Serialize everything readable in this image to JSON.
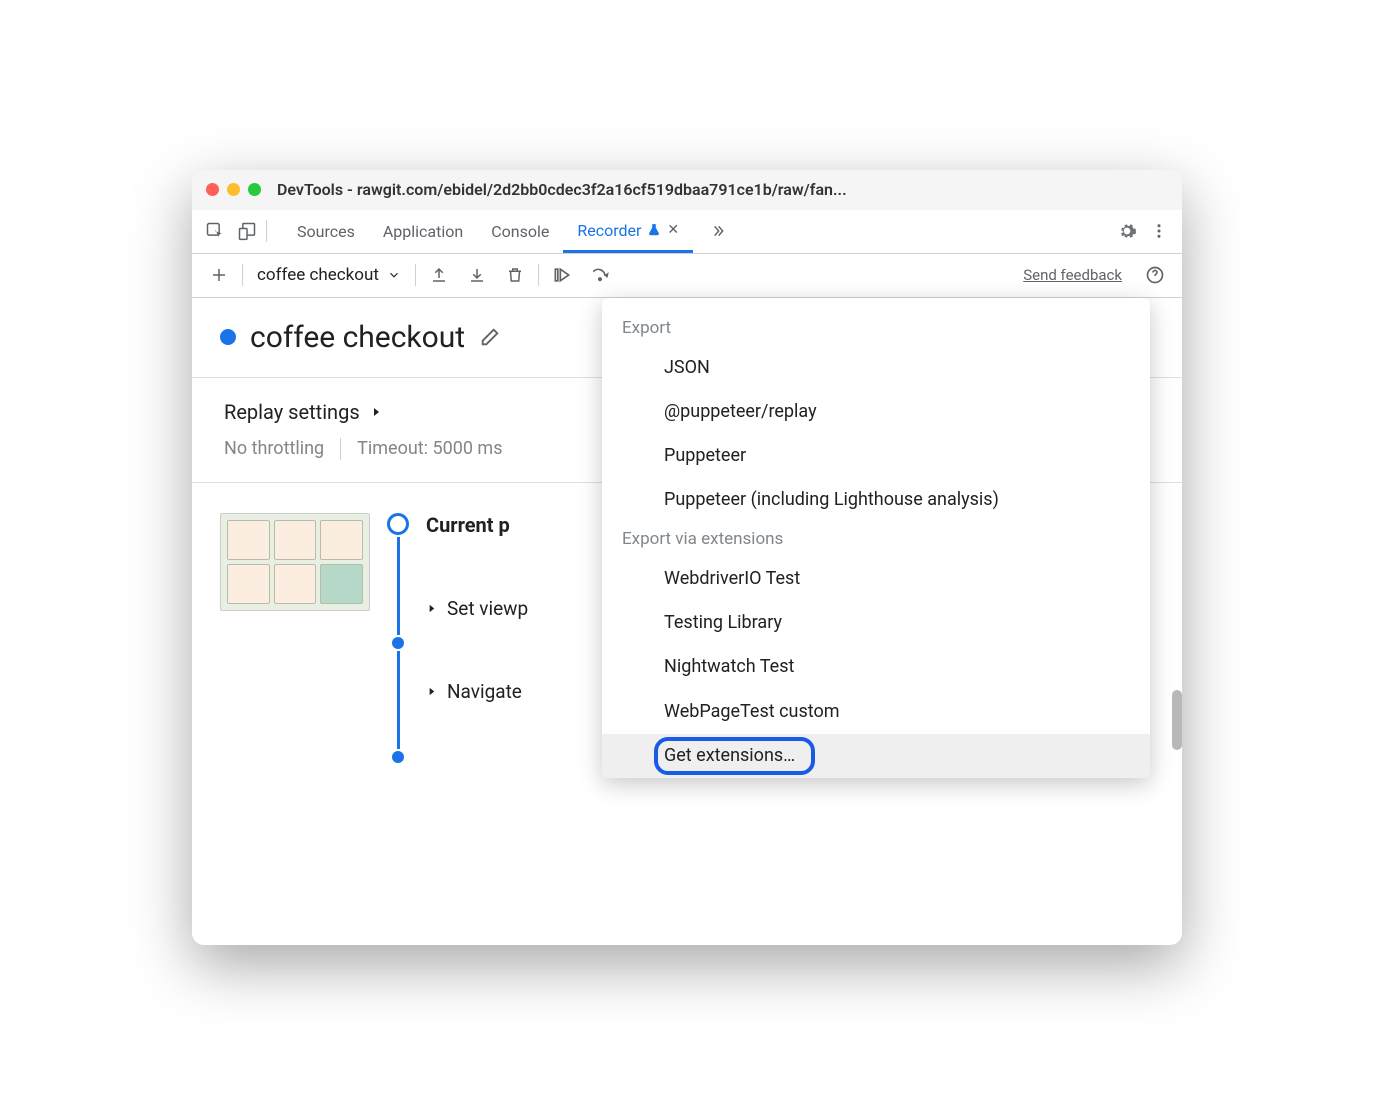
{
  "window": {
    "title": "DevTools - rawgit.com/ebidel/2d2bb0cdec3f2a16cf519dbaa791ce1b/raw/fan..."
  },
  "tabs": {
    "sources": "Sources",
    "application": "Application",
    "console": "Console",
    "recorder": "Recorder"
  },
  "toolbar": {
    "recording_name": "coffee checkout",
    "feedback": "Send feedback"
  },
  "recording": {
    "title": "coffee checkout",
    "replay_settings_label": "Replay settings",
    "throttling": "No throttling",
    "timeout": "Timeout: 5000 ms"
  },
  "steps": {
    "current_page": "Current p",
    "set_viewport": "Set viewp",
    "navigate": "Navigate"
  },
  "dropdown": {
    "section1": "Export",
    "items1": {
      "json": "JSON",
      "puppeteer_replay": "@puppeteer/replay",
      "puppeteer": "Puppeteer",
      "puppeteer_lh": "Puppeteer (including Lighthouse analysis)"
    },
    "section2": "Export via extensions",
    "items2": {
      "webdriverio": "WebdriverIO Test",
      "testing_library": "Testing Library",
      "nightwatch": "Nightwatch Test",
      "webpagetest": "WebPageTest custom",
      "get_extensions": "Get extensions…"
    }
  }
}
